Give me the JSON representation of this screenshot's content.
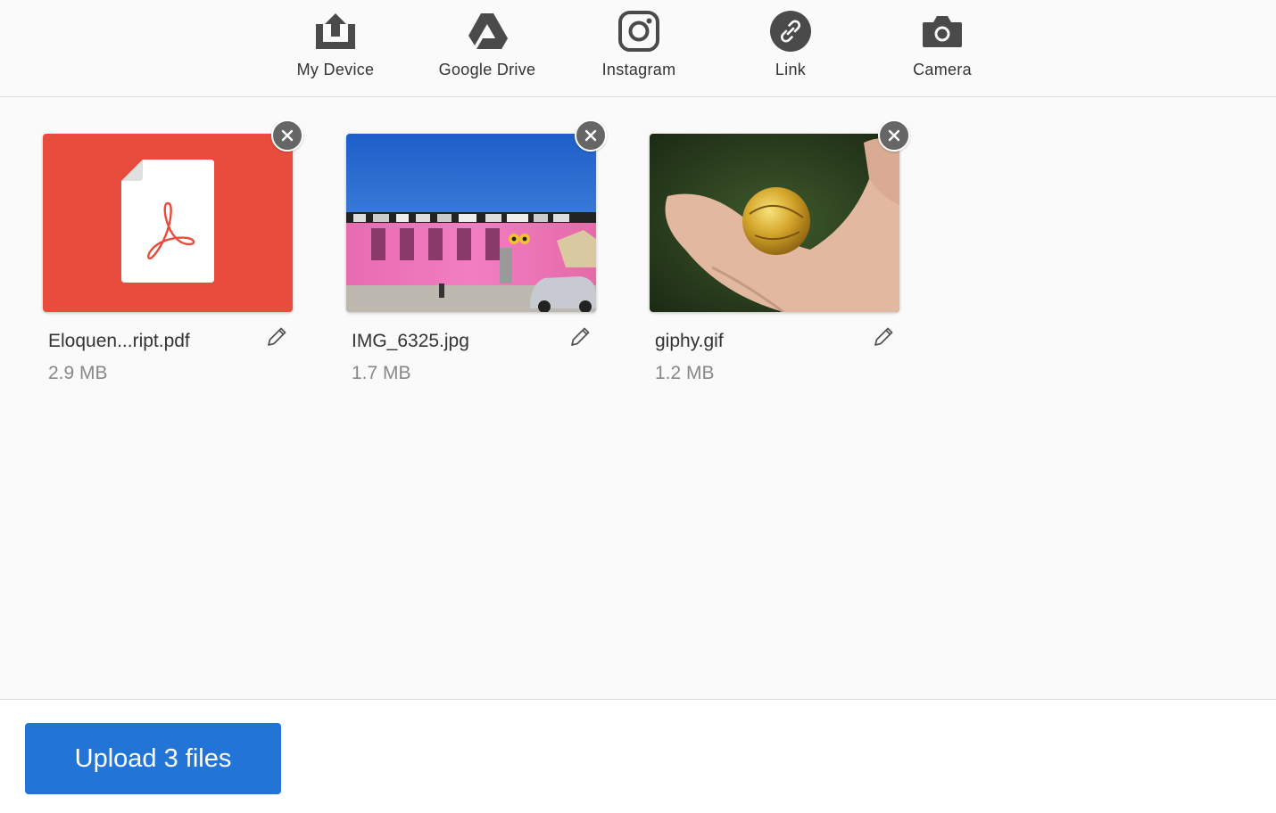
{
  "sources": [
    {
      "label": "My Device",
      "icon": "upload-tray-icon"
    },
    {
      "label": "Google Drive",
      "icon": "google-drive-icon"
    },
    {
      "label": "Instagram",
      "icon": "instagram-icon"
    },
    {
      "label": "Link",
      "icon": "link-icon"
    },
    {
      "label": "Camera",
      "icon": "camera-icon"
    }
  ],
  "files": [
    {
      "name": "Eloquen...ript.pdf",
      "size": "2.9 MB",
      "type": "pdf",
      "thumb_color": "#e74c3c"
    },
    {
      "name": "IMG_6325.jpg",
      "size": "1.7 MB",
      "type": "image"
    },
    {
      "name": "giphy.gif",
      "size": "1.2 MB",
      "type": "image"
    }
  ],
  "footer": {
    "upload_label": "Upload 3 files"
  },
  "colors": {
    "accent": "#2275d7",
    "remove_bg": "#666666",
    "icon": "#4a4a4a"
  }
}
